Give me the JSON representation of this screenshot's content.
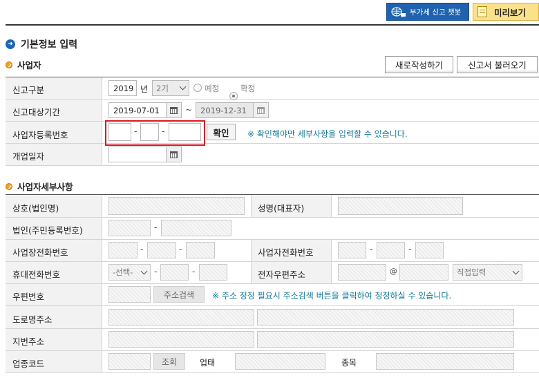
{
  "top_buttons": {
    "chatbot_label": "부가세 신고 챗봇",
    "preview_label": "미리보기"
  },
  "page_title": "기본정보 입력",
  "section_business": {
    "title": "사업자",
    "new_button": "새로작성하기",
    "load_button": "신고서 불러오기",
    "rows": {
      "report_type": {
        "label": "신고구분",
        "year": "2019",
        "year_suffix": "년",
        "period": "2기",
        "radio_expected": "예정",
        "radio_confirmed": "확정"
      },
      "report_period": {
        "label": "신고대상기간",
        "start": "2019-07-01",
        "tilde": "~",
        "end": "2019-12-31"
      },
      "biz_reg_no": {
        "label": "사업자등록번호",
        "confirm_button": "확인",
        "note": "※ 확인해야만 세부사항을 입력할 수 있습니다."
      },
      "open_date": {
        "label": "개업일자"
      }
    }
  },
  "section_detail": {
    "title": "사업자세부사항",
    "labels": {
      "trade_name": "상호(법인명)",
      "rep_name": "성명(대표자)",
      "corp_no": "법인(주민등록번호)",
      "biz_phone": "사업장전화번호",
      "home_phone": "사업자전화번호",
      "mobile": "휴대전화번호",
      "email": "전자우편주소",
      "zip": "우편번호",
      "road_addr": "도로명주소",
      "lot_addr": "지번주소",
      "industry_code": "업종코드",
      "business_type": "업태",
      "business_item": "종목"
    },
    "mobile_select": "-선택-",
    "email_at": "@",
    "email_domain_select": "직접입력",
    "address_search_button": "주소검색",
    "address_note": "※ 주소 정정 필요시 주소검색 버튼을 클릭하여 정정하실 수 있습니다.",
    "lookup_button": "조회",
    "dash": "-"
  },
  "colors": {
    "chatbot_bg": "#1f63b0",
    "preview_bg": "#fbe28a",
    "highlight_box": "#e0141e",
    "note_text": "#127a9a"
  }
}
